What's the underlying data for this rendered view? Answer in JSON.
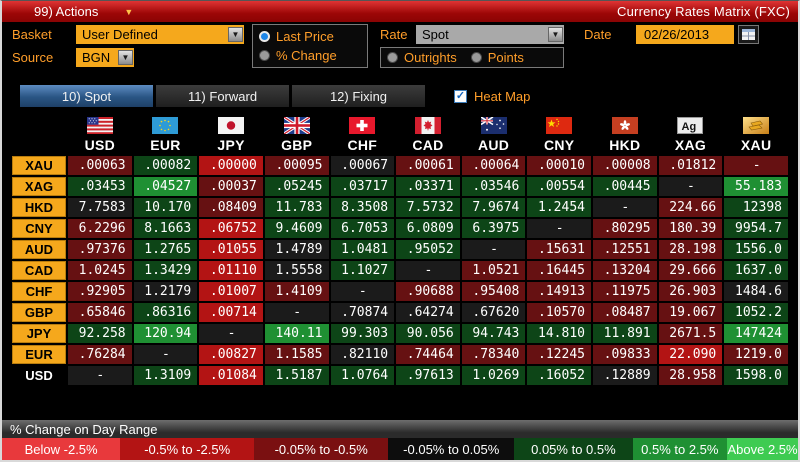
{
  "titlebar": {
    "actions_label": "99) Actions",
    "title": "Currency Rates Matrix (FXC)"
  },
  "toolbar": {
    "basket_label": "Basket",
    "basket_value": "User Defined",
    "source_label": "Source",
    "source_value": "BGN",
    "price_options": [
      {
        "label": "Last Price",
        "selected": true
      },
      {
        "label": "% Change",
        "selected": false
      }
    ],
    "rate_label": "Rate",
    "rate_value": "Spot",
    "rate_options": [
      {
        "label": "Outrights",
        "selected": false
      },
      {
        "label": "Points",
        "selected": false
      }
    ],
    "date_label": "Date",
    "date_value": "02/26/2013"
  },
  "tabs": [
    {
      "label": "10) Spot",
      "active": true
    },
    {
      "label": "11) Forward",
      "active": false
    },
    {
      "label": "12) Fixing",
      "active": false
    }
  ],
  "heatmap": {
    "label": "Heat Map",
    "checked": true
  },
  "heat_colors": {
    "bk": "#1b1b1b",
    "dr": "#661112",
    "mr": "#b31414",
    "dg": "#0d4517",
    "mg": "#1f9033"
  },
  "matrix": {
    "columns": [
      {
        "code": "USD",
        "flag": "us-flag-icon"
      },
      {
        "code": "EUR",
        "flag": "eu-flag-icon"
      },
      {
        "code": "JPY",
        "flag": "jp-flag-icon"
      },
      {
        "code": "GBP",
        "flag": "gb-flag-icon"
      },
      {
        "code": "CHF",
        "flag": "ch-flag-icon"
      },
      {
        "code": "CAD",
        "flag": "ca-flag-icon"
      },
      {
        "code": "AUD",
        "flag": "au-flag-icon"
      },
      {
        "code": "CNY",
        "flag": "cn-flag-icon"
      },
      {
        "code": "HKD",
        "flag": "hk-flag-icon"
      },
      {
        "code": "XAG",
        "flag": "silver-icon",
        "flag_text": "Ag"
      },
      {
        "code": "XAU",
        "flag": "gold-icon"
      }
    ],
    "rows": [
      {
        "label": "XAU",
        "style": "orange",
        "cells": [
          [
            ".00063",
            "dr"
          ],
          [
            ".00082",
            "dg"
          ],
          [
            ".00000",
            "mr"
          ],
          [
            ".00095",
            "dr"
          ],
          [
            ".00067",
            "bk"
          ],
          [
            ".00061",
            "dr"
          ],
          [
            ".00064",
            "dr"
          ],
          [
            ".00010",
            "dr"
          ],
          [
            ".00008",
            "dr"
          ],
          [
            ".01812",
            "dr"
          ],
          [
            "-",
            "dr"
          ]
        ]
      },
      {
        "label": "XAG",
        "style": "orange",
        "cells": [
          [
            ".03453",
            "dg"
          ],
          [
            ".04527",
            "mg"
          ],
          [
            ".00037",
            "dr"
          ],
          [
            ".05245",
            "dg"
          ],
          [
            ".03717",
            "dg"
          ],
          [
            ".03371",
            "dg"
          ],
          [
            ".03546",
            "dg"
          ],
          [
            ".00554",
            "dg"
          ],
          [
            ".00445",
            "dg"
          ],
          [
            "-",
            "bk"
          ],
          [
            "55.183",
            "mg"
          ]
        ]
      },
      {
        "label": "HKD",
        "style": "orange",
        "cells": [
          [
            "7.7583",
            "bk"
          ],
          [
            "10.170",
            "dg"
          ],
          [
            ".08409",
            "dr"
          ],
          [
            "11.783",
            "dg"
          ],
          [
            "8.3508",
            "dg"
          ],
          [
            "7.5732",
            "dg"
          ],
          [
            "7.9674",
            "dg"
          ],
          [
            "1.2454",
            "dg"
          ],
          [
            "-",
            "bk"
          ],
          [
            "224.66",
            "dr"
          ],
          [
            "12398",
            "dg"
          ]
        ]
      },
      {
        "label": "CNY",
        "style": "orange",
        "cells": [
          [
            "6.2296",
            "dr"
          ],
          [
            "8.1663",
            "dg"
          ],
          [
            ".06752",
            "mr"
          ],
          [
            "9.4609",
            "dg"
          ],
          [
            "6.7053",
            "dg"
          ],
          [
            "6.0809",
            "dg"
          ],
          [
            "6.3975",
            "dg"
          ],
          [
            "-",
            "bk"
          ],
          [
            ".80295",
            "dr"
          ],
          [
            "180.39",
            "dr"
          ],
          [
            "9954.7",
            "dg"
          ]
        ]
      },
      {
        "label": "AUD",
        "style": "orange",
        "cells": [
          [
            ".97376",
            "dr"
          ],
          [
            "1.2765",
            "dg"
          ],
          [
            ".01055",
            "mr"
          ],
          [
            "1.4789",
            "bk"
          ],
          [
            "1.0481",
            "dg"
          ],
          [
            ".95052",
            "dg"
          ],
          [
            "-",
            "bk"
          ],
          [
            ".15631",
            "dr"
          ],
          [
            ".12551",
            "dr"
          ],
          [
            "28.198",
            "dr"
          ],
          [
            "1556.0",
            "dg"
          ]
        ]
      },
      {
        "label": "CAD",
        "style": "orange",
        "cells": [
          [
            "1.0245",
            "dr"
          ],
          [
            "1.3429",
            "dg"
          ],
          [
            ".01110",
            "mr"
          ],
          [
            "1.5558",
            "bk"
          ],
          [
            "1.1027",
            "dg"
          ],
          [
            "-",
            "bk"
          ],
          [
            "1.0521",
            "dr"
          ],
          [
            ".16445",
            "dr"
          ],
          [
            ".13204",
            "dr"
          ],
          [
            "29.666",
            "dr"
          ],
          [
            "1637.0",
            "dg"
          ]
        ]
      },
      {
        "label": "CHF",
        "style": "orange",
        "cells": [
          [
            ".92905",
            "dr"
          ],
          [
            "1.2179",
            "bk"
          ],
          [
            ".01007",
            "mr"
          ],
          [
            "1.4109",
            "dr"
          ],
          [
            "-",
            "bk"
          ],
          [
            ".90688",
            "dr"
          ],
          [
            ".95408",
            "dr"
          ],
          [
            ".14913",
            "dr"
          ],
          [
            ".11975",
            "dr"
          ],
          [
            "26.903",
            "dr"
          ],
          [
            "1484.6",
            "bk"
          ]
        ]
      },
      {
        "label": "GBP",
        "style": "orange",
        "cells": [
          [
            ".65846",
            "dr"
          ],
          [
            ".86316",
            "dg"
          ],
          [
            ".00714",
            "mr"
          ],
          [
            "-",
            "bk"
          ],
          [
            ".70874",
            "bk"
          ],
          [
            ".64274",
            "bk"
          ],
          [
            ".67620",
            "bk"
          ],
          [
            ".10570",
            "dr"
          ],
          [
            ".08487",
            "dr"
          ],
          [
            "19.067",
            "dr"
          ],
          [
            "1052.2",
            "dg"
          ]
        ]
      },
      {
        "label": "JPY",
        "style": "orange",
        "cells": [
          [
            "92.258",
            "dg"
          ],
          [
            "120.94",
            "mg"
          ],
          [
            "-",
            "bk"
          ],
          [
            "140.11",
            "mg"
          ],
          [
            "99.303",
            "dg"
          ],
          [
            "90.056",
            "dg"
          ],
          [
            "94.743",
            "dg"
          ],
          [
            "14.810",
            "dg"
          ],
          [
            "11.891",
            "dg"
          ],
          [
            "2671.5",
            "dr"
          ],
          [
            "147424",
            "mg"
          ]
        ]
      },
      {
        "label": "EUR",
        "style": "orange",
        "cells": [
          [
            ".76284",
            "dr"
          ],
          [
            "-",
            "bk"
          ],
          [
            ".00827",
            "mr"
          ],
          [
            "1.1585",
            "dr"
          ],
          [
            ".82110",
            "bk"
          ],
          [
            ".74464",
            "dr"
          ],
          [
            ".78340",
            "dr"
          ],
          [
            ".12245",
            "dr"
          ],
          [
            ".09833",
            "dr"
          ],
          [
            "22.090",
            "mr"
          ],
          [
            "1219.0",
            "dr"
          ]
        ]
      },
      {
        "label": "USD",
        "style": "plain",
        "cells": [
          [
            "-",
            "bk"
          ],
          [
            "1.3109",
            "dg"
          ],
          [
            ".01084",
            "mr"
          ],
          [
            "1.5187",
            "dg"
          ],
          [
            "1.0764",
            "dg"
          ],
          [
            ".97613",
            "dg"
          ],
          [
            "1.0269",
            "dg"
          ],
          [
            ".16052",
            "dg"
          ],
          [
            ".12889",
            "bk"
          ],
          [
            "28.958",
            "dr"
          ],
          [
            "1598.0",
            "dg"
          ]
        ]
      }
    ]
  },
  "legend": {
    "title": "% Change on Day Range",
    "ranges": [
      {
        "label": "Below -2.5%",
        "color": "#e8393c",
        "w": 15
      },
      {
        "label": "-0.5% to -2.5%",
        "color": "#b31414",
        "w": 17
      },
      {
        "label": "-0.05% to -0.5%",
        "color": "#7a1011",
        "w": 17
      },
      {
        "label": "-0.05% to 0.05%",
        "color": "#0d0d0d",
        "w": 16
      },
      {
        "label": "0.05% to 0.5%",
        "color": "#0d4517",
        "w": 15
      },
      {
        "label": "0.5% to 2.5%",
        "color": "#1f9033",
        "w": 12
      },
      {
        "label": "Above 2.5%",
        "color": "#3ecb52",
        "w": 9
      }
    ]
  }
}
